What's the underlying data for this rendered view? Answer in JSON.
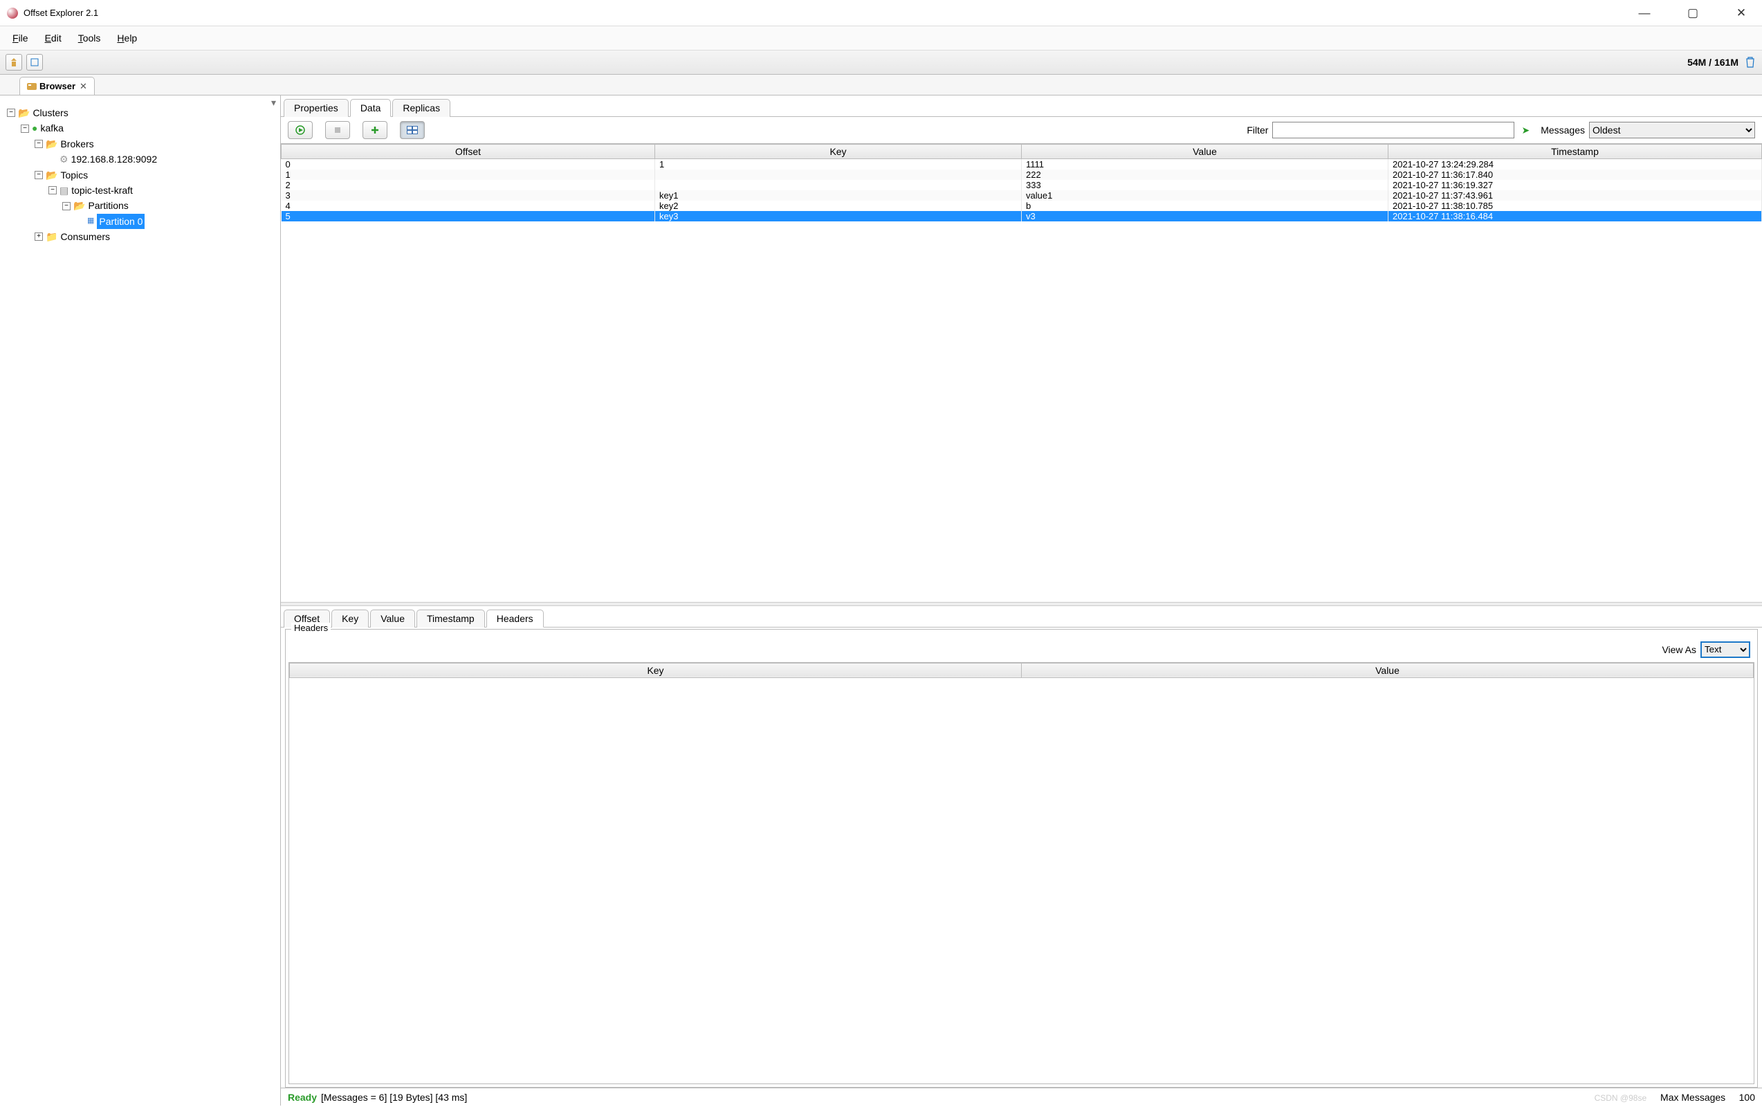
{
  "app": {
    "title": "Offset Explorer  2.1"
  },
  "menu": {
    "file": "File",
    "edit": "Edit",
    "tools": "Tools",
    "help": "Help"
  },
  "toolbar": {
    "memory": "54M / 161M"
  },
  "browserTab": {
    "label": "Browser"
  },
  "tree": {
    "clusters": "Clusters",
    "kafka": "kafka",
    "brokers": "Brokers",
    "broker0": "192.168.8.128:9092",
    "topics": "Topics",
    "topic0": "topic-test-kraft",
    "partitions": "Partitions",
    "partition0": "Partition 0",
    "consumers": "Consumers"
  },
  "contentTabs": {
    "t0": "Properties",
    "t1": "Data",
    "t2": "Replicas"
  },
  "tbrow": {
    "filter_label": "Filter",
    "filter_value": "",
    "messages_label": "Messages",
    "messages_select": "Oldest"
  },
  "columns": {
    "c0": "Offset",
    "c1": "Key",
    "c2": "Value",
    "c3": "Timestamp"
  },
  "rows": [
    {
      "offset": "0",
      "key": "1",
      "value": "1111",
      "ts": "2021-10-27 13:24:29.284"
    },
    {
      "offset": "1",
      "key": "",
      "value": "222",
      "ts": "2021-10-27 11:36:17.840"
    },
    {
      "offset": "2",
      "key": "",
      "value": "333",
      "ts": "2021-10-27 11:36:19.327"
    },
    {
      "offset": "3",
      "key": "key1",
      "value": "value1",
      "ts": "2021-10-27 11:37:43.961"
    },
    {
      "offset": "4",
      "key": "key2",
      "value": "b",
      "ts": "2021-10-27 11:38:10.785"
    },
    {
      "offset": "5",
      "key": "key3",
      "value": "v3",
      "ts": "2021-10-27 11:38:16.484"
    }
  ],
  "detailTabs": {
    "d0": "Offset",
    "d1": "Key",
    "d2": "Value",
    "d3": "Timestamp",
    "d4": "Headers"
  },
  "headers": {
    "group_label": "Headers",
    "view_as_label": "View As",
    "view_as_value": "Text",
    "cols": {
      "c0": "Key",
      "c1": "Value"
    }
  },
  "status": {
    "ready": "Ready",
    "info": "[Messages = 6]  [19 Bytes]  [43 ms]",
    "max_label": "Max Messages",
    "max_value": "100",
    "watermark": "CSDN @98se"
  }
}
